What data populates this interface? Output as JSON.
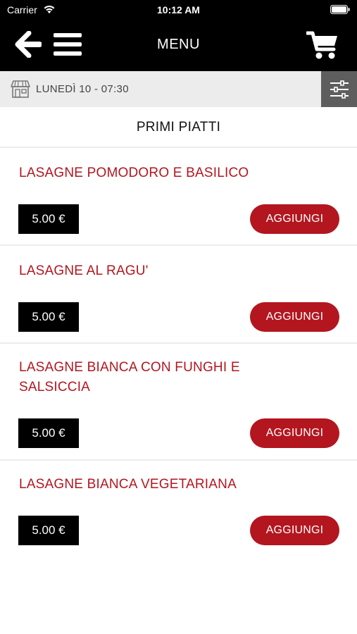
{
  "status_bar": {
    "carrier": "Carrier",
    "time": "10:12 AM"
  },
  "nav": {
    "title": "MENU",
    "icons": [
      "arrow-left-icon",
      "hamburger-icon",
      "cart-icon"
    ]
  },
  "info_bar": {
    "date": "LUNEDÌ 10 - 07:30",
    "icons": [
      "shop-icon",
      "sliders-icon"
    ]
  },
  "section": {
    "title": "PRIMI PIATTI"
  },
  "items": [
    {
      "name": "LASAGNE POMODORO E BASILICO",
      "price": "5.00 €",
      "button": "AGGIUNGI"
    },
    {
      "name": "LASAGNE AL RAGU'",
      "price": "5.00 €",
      "button": "AGGIUNGI"
    },
    {
      "name": "LASAGNE BIANCA CON FUNGHI E SALSICCIA",
      "price": "5.00 €",
      "button": "AGGIUNGI"
    },
    {
      "name": "LASAGNE BIANCA VEGETARIANA",
      "price": "5.00 €",
      "button": "AGGIUNGI"
    }
  ],
  "colors": {
    "header_bg": "#000000",
    "accent": "#b3161f",
    "price_bg": "#000000",
    "info_bar_bg": "#ececec",
    "filter_bg": "#5e5e5e"
  }
}
